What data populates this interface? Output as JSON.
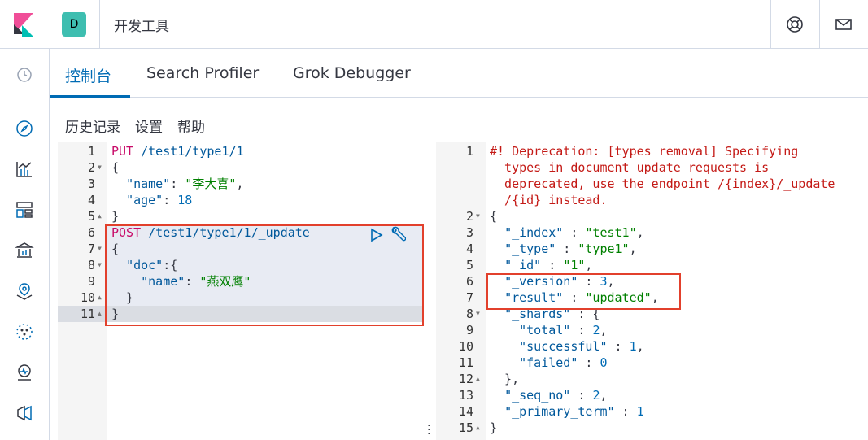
{
  "header": {
    "avatar_letter": "D",
    "app_title": "开发工具",
    "icons": [
      "kibana-logo-icon",
      "help-lifebuoy-icon",
      "mail-icon"
    ]
  },
  "sidenav": {
    "items": [
      "clock-icon",
      "compass-icon",
      "visualize-icon",
      "dashboard-icon",
      "canvas-icon",
      "maps-icon",
      "ml-icon",
      "uptime-icon",
      "infra-icon"
    ]
  },
  "tabs": [
    {
      "label": "控制台",
      "active": true
    },
    {
      "label": "Search Profiler",
      "active": false
    },
    {
      "label": "Grok Debugger",
      "active": false
    }
  ],
  "menu": {
    "history": "历史记录",
    "settings": "设置",
    "help": "帮助"
  },
  "left_editor": {
    "line_numbers": [
      "1",
      "2",
      "3",
      "4",
      "5",
      "6",
      "7",
      "8",
      "9",
      "10",
      "11"
    ],
    "folds": {
      "2": "down",
      "5": "up",
      "7": "down",
      "8": "down",
      "10": "up",
      "11": "up"
    },
    "lines": [
      [
        [
          "m",
          "PUT"
        ],
        [
          "p",
          " "
        ],
        [
          "u",
          "/test1/type1/1"
        ]
      ],
      [
        [
          "p",
          "{"
        ]
      ],
      [
        [
          "p",
          "  "
        ],
        [
          "k",
          "\"name\""
        ],
        [
          "p",
          ": "
        ],
        [
          "s",
          "\"李大喜\""
        ],
        [
          "p",
          ","
        ]
      ],
      [
        [
          "p",
          "  "
        ],
        [
          "k",
          "\"age\""
        ],
        [
          "p",
          ": "
        ],
        [
          "n",
          "18"
        ]
      ],
      [
        [
          "p",
          "}"
        ]
      ],
      [
        [
          "m",
          "POST"
        ],
        [
          "p",
          " "
        ],
        [
          "u",
          "/test1/type1/1/_update"
        ]
      ],
      [
        [
          "p",
          "{"
        ]
      ],
      [
        [
          "p",
          "  "
        ],
        [
          "k",
          "\"doc\""
        ],
        [
          "p",
          ":{"
        ]
      ],
      [
        [
          "p",
          "    "
        ],
        [
          "k",
          "\"name\""
        ],
        [
          "p",
          ": "
        ],
        [
          "s",
          "\"燕双鹰\""
        ]
      ],
      [
        [
          "p",
          "  }"
        ]
      ],
      [
        [
          "p",
          "}"
        ]
      ]
    ]
  },
  "right_editor": {
    "line_numbers": [
      "1",
      "",
      "",
      "",
      "2",
      "3",
      "4",
      "5",
      "6",
      "7",
      "8",
      "9",
      "10",
      "11",
      "12",
      "13",
      "14",
      "15"
    ],
    "folds": {
      "2": "down",
      "8": "down",
      "12": "up",
      "15": "up"
    },
    "lines": [
      [
        [
          "c",
          "#! Deprecation: [types removal] Specifying"
        ]
      ],
      [
        [
          "c",
          "  types in document update requests is"
        ]
      ],
      [
        [
          "c",
          "  deprecated, use the endpoint /{index}/_update"
        ]
      ],
      [
        [
          "c",
          "  /{id} instead."
        ]
      ],
      [
        [
          "p",
          "{"
        ]
      ],
      [
        [
          "p",
          "  "
        ],
        [
          "k",
          "\"_index\""
        ],
        [
          "p",
          " : "
        ],
        [
          "s",
          "\"test1\""
        ],
        [
          "p",
          ","
        ]
      ],
      [
        [
          "p",
          "  "
        ],
        [
          "k",
          "\"_type\""
        ],
        [
          "p",
          " : "
        ],
        [
          "s",
          "\"type1\""
        ],
        [
          "p",
          ","
        ]
      ],
      [
        [
          "p",
          "  "
        ],
        [
          "k",
          "\"_id\""
        ],
        [
          "p",
          " : "
        ],
        [
          "s",
          "\"1\""
        ],
        [
          "p",
          ","
        ]
      ],
      [
        [
          "p",
          "  "
        ],
        [
          "k",
          "\"_version\""
        ],
        [
          "p",
          " : "
        ],
        [
          "n",
          "3"
        ],
        [
          "p",
          ","
        ]
      ],
      [
        [
          "p",
          "  "
        ],
        [
          "k",
          "\"result\""
        ],
        [
          "p",
          " : "
        ],
        [
          "s",
          "\"updated\""
        ],
        [
          "p",
          ","
        ]
      ],
      [
        [
          "p",
          "  "
        ],
        [
          "k",
          "\"_shards\""
        ],
        [
          "p",
          " : {"
        ]
      ],
      [
        [
          "p",
          "    "
        ],
        [
          "k",
          "\"total\""
        ],
        [
          "p",
          " : "
        ],
        [
          "n",
          "2"
        ],
        [
          "p",
          ","
        ]
      ],
      [
        [
          "p",
          "    "
        ],
        [
          "k",
          "\"successful\""
        ],
        [
          "p",
          " : "
        ],
        [
          "n",
          "1"
        ],
        [
          "p",
          ","
        ]
      ],
      [
        [
          "p",
          "    "
        ],
        [
          "k",
          "\"failed\""
        ],
        [
          "p",
          " : "
        ],
        [
          "n",
          "0"
        ]
      ],
      [
        [
          "p",
          "  },"
        ]
      ],
      [
        [
          "p",
          "  "
        ],
        [
          "k",
          "\"_seq_no\""
        ],
        [
          "p",
          " : "
        ],
        [
          "n",
          "2"
        ],
        [
          "p",
          ","
        ]
      ],
      [
        [
          "p",
          "  "
        ],
        [
          "k",
          "\"_primary_term\""
        ],
        [
          "p",
          " : "
        ],
        [
          "n",
          "1"
        ]
      ],
      [
        [
          "p",
          "}"
        ]
      ]
    ]
  },
  "colors": {
    "accent": "#006bb4",
    "highlight_box": "#e2402c",
    "avatar": "#3ebeb0"
  }
}
